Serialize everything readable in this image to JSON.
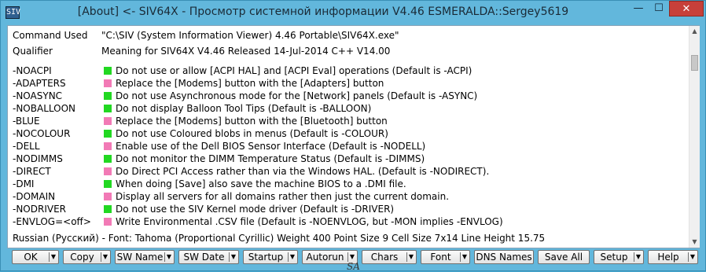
{
  "window": {
    "title": "[About] <- SIV64X - Просмотр системной информации V4.46 ESMERALDA::Sergey5619",
    "app_icon_text": "SIV",
    "minimize_glyph": "—",
    "maximize_glyph": "☐",
    "close_glyph": "✕"
  },
  "meta": {
    "command_label": "Command Used",
    "command_value": "\"C:\\SIV (System Information Viewer) 4.46 Portable\\SIV64X.exe\"",
    "qualifier_label": "Qualifier",
    "qualifier_value": "Meaning for SIV64X V4.46  Released 14-Jul-2014 C++ V14.00"
  },
  "colors": {
    "green": "#22d822",
    "pink": "#f27ab6"
  },
  "options": [
    {
      "flag": "-NOACPI",
      "color": "green",
      "desc": "Do not use or allow [ACPI HAL] and [ACPI Eval] operations (Default is -ACPI)"
    },
    {
      "flag": "-ADAPTERS",
      "color": "pink",
      "desc": "Replace the [Modems] button with the [Adapters] button"
    },
    {
      "flag": "-NOASYNC",
      "color": "green",
      "desc": "Do not use Asynchronous mode for the [Network] panels (Default is -ASYNC)"
    },
    {
      "flag": "-NOBALLOON",
      "color": "green",
      "desc": "Do not display Balloon Tool Tips (Default is -BALLOON)"
    },
    {
      "flag": "-BLUE",
      "color": "pink",
      "desc": "Replace the [Modems] button with the [Bluetooth] button"
    },
    {
      "flag": "-NOCOLOUR",
      "color": "green",
      "desc": "Do not use Coloured blobs in menus (Default is -COLOUR)"
    },
    {
      "flag": "-DELL",
      "color": "pink",
      "desc": "Enable use of the Dell BIOS Sensor Interface (Default is -NODELL)"
    },
    {
      "flag": "-NODIMMS",
      "color": "green",
      "desc": "Do not monitor the DIMM Temperature Status (Default is -DIMMS)"
    },
    {
      "flag": "-DIRECT",
      "color": "pink",
      "desc": "Do Direct PCI Access rather than via the Windows HAL. (Default is -NODIRECT)."
    },
    {
      "flag": "-DMI",
      "color": "green",
      "desc": "When doing [Save] also save the machine BIOS to a .DMI file."
    },
    {
      "flag": "-DOMAIN",
      "color": "pink",
      "desc": "Display all servers for all domains rather then just the current domain."
    },
    {
      "flag": "-NODRIVER",
      "color": "green",
      "desc": "Do not use the SIV Kernel mode driver (Default is -DRIVER)"
    },
    {
      "flag": "-ENVLOG=<off>",
      "color": "pink",
      "desc": "Write Environmental .CSV file (Default is -NOENVLOG, but -MON implies -ENVLOG)"
    }
  ],
  "status": "Russian (Русский) - Font: Tahoma (Proportional Cyrillic)  Weight 400  Point Size 9  Cell Size 7x14  Line Height 15.75",
  "buttons": [
    {
      "name": "ok-button",
      "label": "OK",
      "dropdown": true
    },
    {
      "name": "copy-button",
      "label": "Copy",
      "dropdown": true
    },
    {
      "name": "sw-name-button",
      "label": "SW Name",
      "dropdown": true
    },
    {
      "name": "sw-date-button",
      "label": "SW Date",
      "dropdown": true
    },
    {
      "name": "startup-button",
      "label": "Startup",
      "dropdown": true
    },
    {
      "name": "autorun-button",
      "label": "Autorun",
      "dropdown": true
    },
    {
      "name": "chars-button",
      "label": "Chars",
      "dropdown": true
    },
    {
      "name": "font-button",
      "label": "Font",
      "dropdown": true
    },
    {
      "name": "dns-names-button",
      "label": "DNS Names",
      "dropdown": false
    },
    {
      "name": "save-all-button",
      "label": "Save All",
      "dropdown": false
    },
    {
      "name": "setup-button",
      "label": "Setup",
      "dropdown": true
    },
    {
      "name": "help-button",
      "label": "Help",
      "dropdown": true
    }
  ],
  "dropdown_glyph": "▼",
  "scroll_up_glyph": "▲",
  "scroll_down_glyph": "▼",
  "watermark": "SA"
}
